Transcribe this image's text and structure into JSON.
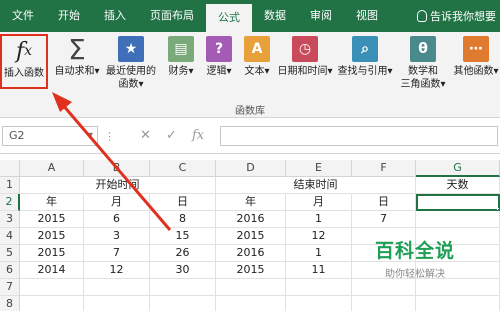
{
  "menubar": {
    "tabs": [
      "文件",
      "开始",
      "插入",
      "页面布局",
      "公式",
      "数据",
      "审阅",
      "视图"
    ],
    "active_tab": "公式",
    "tell_me": "告诉我你想要",
    "colors": {
      "background": "#217346",
      "active_text": "#217346"
    }
  },
  "ribbon": {
    "buttons": [
      {
        "label": "插入函数",
        "icon": "fx-icon"
      },
      {
        "label": "自动求和",
        "icon": "sigma-icon"
      },
      {
        "label": "最近使用的",
        "label2": "函数",
        "icon": "star-book-icon"
      },
      {
        "label": "财务",
        "icon": "coins-book-icon"
      },
      {
        "label": "逻辑",
        "icon": "question-book-icon"
      },
      {
        "label": "文本",
        "icon": "text-book-icon"
      },
      {
        "label": "日期和时间",
        "icon": "clock-book-icon"
      },
      {
        "label": "查找与引用",
        "icon": "search-book-icon"
      },
      {
        "label": "数学和",
        "label2": "三角函数",
        "icon": "theta-book-icon"
      },
      {
        "label": "其他函数",
        "icon": "more-book-icon"
      }
    ],
    "group_label": "函数库",
    "dropdown_glyph": "▾",
    "highlight_color": "#e0301e"
  },
  "formulabar": {
    "namebox": "G2",
    "cancel_icon": "✕",
    "enter_icon": "✓",
    "fx": "fx",
    "formula": ""
  },
  "sheet": {
    "columns": [
      "A",
      "B",
      "C",
      "D",
      "E",
      "F",
      "G"
    ],
    "selected_column": "G",
    "selected_row": "2",
    "rows": [
      {
        "num": "1",
        "merged_start": "开始时间",
        "merged_end": "结束时间",
        "g": "天数"
      },
      {
        "num": "2",
        "cells": [
          "年",
          "月",
          "日",
          "年",
          "月",
          "日",
          ""
        ]
      },
      {
        "num": "3",
        "cells": [
          "2015",
          "6",
          "8",
          "2016",
          "1",
          "7",
          ""
        ]
      },
      {
        "num": "4",
        "cells": [
          "2015",
          "3",
          "15",
          "2015",
          "12",
          "",
          ""
        ]
      },
      {
        "num": "5",
        "cells": [
          "2015",
          "7",
          "26",
          "2016",
          "1",
          "",
          ""
        ]
      },
      {
        "num": "6",
        "cells": [
          "2014",
          "12",
          "30",
          "2015",
          "11",
          "",
          ""
        ]
      },
      {
        "num": "7",
        "cells": [
          "",
          "",
          "",
          "",
          "",
          "",
          ""
        ]
      },
      {
        "num": "8",
        "cells": [
          "",
          "",
          "",
          "",
          "",
          "",
          ""
        ]
      }
    ]
  },
  "watermark": {
    "title": "百科全说",
    "subtitle": "助你轻松解决",
    "color": "#1f9e55"
  }
}
